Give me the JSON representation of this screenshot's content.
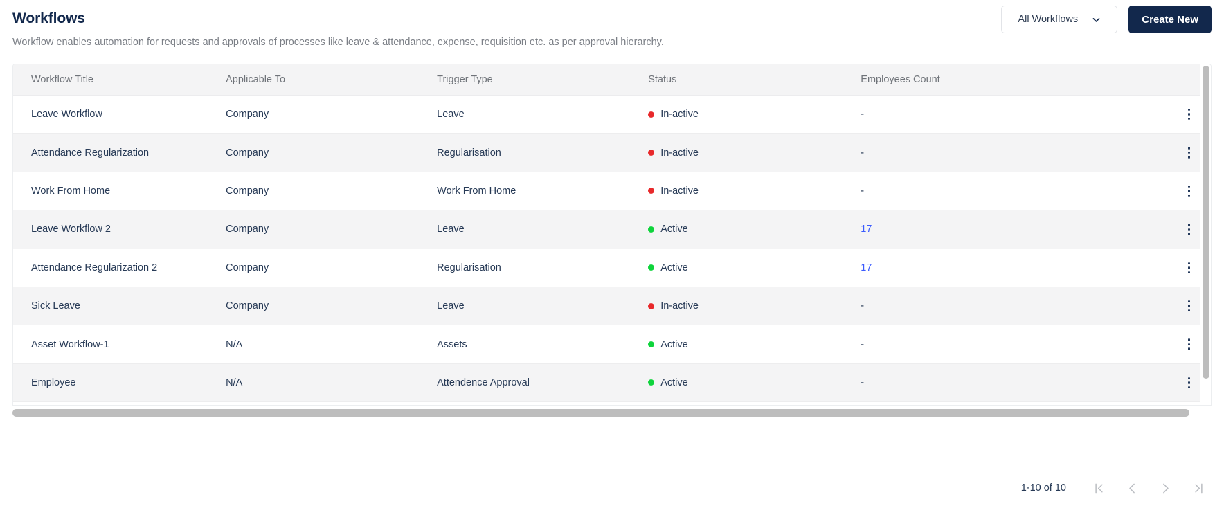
{
  "header": {
    "title": "Workflows",
    "subtitle": "Workflow enables automation for requests and approvals of processes like leave & attendance, expense, requisition etc. as per approval hierarchy.",
    "filter_label": "All Workflows",
    "create_label": "Create New"
  },
  "colors": {
    "brand_navy": "#12284c",
    "active_green": "#0fd43c",
    "inactive_red": "#e8292b",
    "link_blue": "#3b5bfe",
    "header_bg": "#f4f4f5",
    "row_alt_bg": "#f4f4f5"
  },
  "table": {
    "columns": [
      "Workflow Title",
      "Applicable To",
      "Trigger Type",
      "Status",
      "Employees Count"
    ],
    "rows": [
      {
        "title": "Leave Workflow",
        "applicable_to": "Company",
        "trigger_type": "Leave",
        "status": "In-active",
        "status_state": "inactive",
        "employees_count": "-",
        "count_is_link": false
      },
      {
        "title": "Attendance Regularization",
        "applicable_to": "Company",
        "trigger_type": "Regularisation",
        "status": "In-active",
        "status_state": "inactive",
        "employees_count": "-",
        "count_is_link": false
      },
      {
        "title": "Work From Home",
        "applicable_to": "Company",
        "trigger_type": "Work From Home",
        "status": "In-active",
        "status_state": "inactive",
        "employees_count": "-",
        "count_is_link": false
      },
      {
        "title": "Leave Workflow 2",
        "applicable_to": "Company",
        "trigger_type": "Leave",
        "status": "Active",
        "status_state": "active",
        "employees_count": "17",
        "count_is_link": true
      },
      {
        "title": "Attendance Regularization 2",
        "applicable_to": "Company",
        "trigger_type": "Regularisation",
        "status": "Active",
        "status_state": "active",
        "employees_count": "17",
        "count_is_link": true
      },
      {
        "title": "Sick Leave",
        "applicable_to": "Company",
        "trigger_type": "Leave",
        "status": "In-active",
        "status_state": "inactive",
        "employees_count": "-",
        "count_is_link": false
      },
      {
        "title": "Asset Workflow-1",
        "applicable_to": "N/A",
        "trigger_type": "Assets",
        "status": "Active",
        "status_state": "active",
        "employees_count": "-",
        "count_is_link": false
      },
      {
        "title": "Employee",
        "applicable_to": "N/A",
        "trigger_type": "Attendence Approval",
        "status": "Active",
        "status_state": "active",
        "employees_count": "-",
        "count_is_link": false
      }
    ]
  },
  "pagination": {
    "range_label": "1-10 of 10",
    "first_label": "|<",
    "prev_label": "<",
    "next_label": ">",
    "last_label": ">|"
  }
}
